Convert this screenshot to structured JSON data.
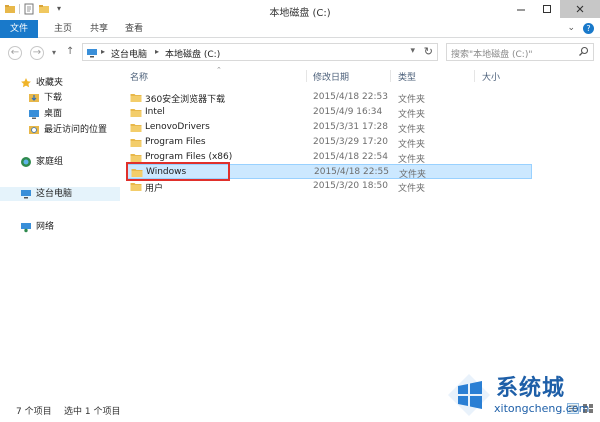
{
  "window": {
    "title": "本地磁盘 (C:)"
  },
  "ribbon": {
    "tabs": [
      {
        "label": "文件"
      },
      {
        "label": "主页"
      },
      {
        "label": "共享"
      },
      {
        "label": "查看"
      }
    ]
  },
  "address": {
    "crumbs": [
      "这台电脑",
      "本地磁盘 (C:)"
    ],
    "search_placeholder": "搜索\"本地磁盘 (C:)\""
  },
  "nav": {
    "favorites": "收藏夹",
    "downloads": "下载",
    "desktop": "桌面",
    "recent": "最近访问的位置",
    "homegroup": "家庭组",
    "this_pc": "这台电脑",
    "network": "网络"
  },
  "columns": {
    "name": "名称",
    "date": "修改日期",
    "type": "类型",
    "size": "大小"
  },
  "files": [
    {
      "name": "360安全浏览器下载",
      "date": "2015/4/18 22:53",
      "type": "文件夹"
    },
    {
      "name": "Intel",
      "date": "2015/4/9 16:34",
      "type": "文件夹"
    },
    {
      "name": "LenovoDrivers",
      "date": "2015/3/31 17:28",
      "type": "文件夹"
    },
    {
      "name": "Program Files",
      "date": "2015/3/29 17:20",
      "type": "文件夹"
    },
    {
      "name": "Program Files (x86)",
      "date": "2015/4/18 22:54",
      "type": "文件夹"
    },
    {
      "name": "Windows",
      "date": "2015/4/18 22:55",
      "type": "文件夹"
    },
    {
      "name": "用户",
      "date": "2015/3/20 18:50",
      "type": "文件夹"
    }
  ],
  "status": {
    "count": "7 个项目",
    "selected": "选中 1 个项目"
  },
  "watermark": {
    "brand": "系统城",
    "url": "xitongcheng.com"
  },
  "colors": {
    "accent": "#1979ca",
    "selection": "#cce8ff",
    "highlight": "#e0302b",
    "folder": "#e8b84a"
  }
}
